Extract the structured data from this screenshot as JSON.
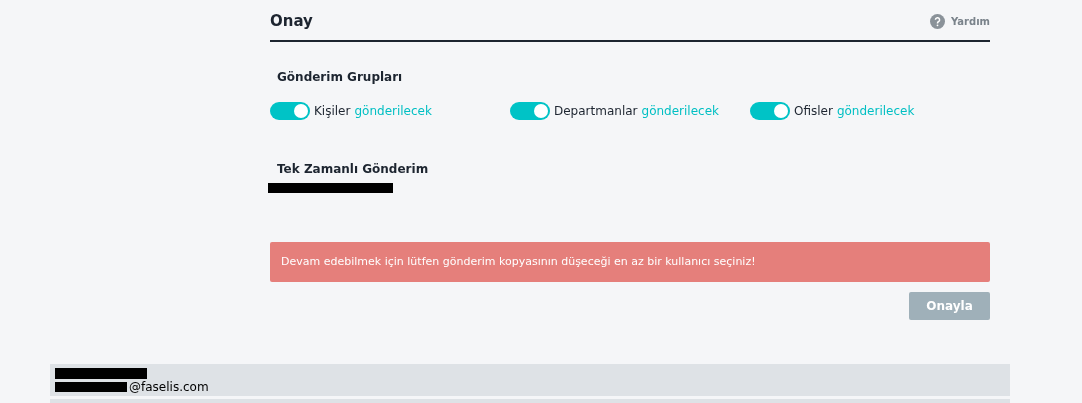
{
  "header": {
    "title": "Onay",
    "help_label": "Yardım"
  },
  "groups": {
    "heading": "Gönderim Grupları",
    "items": [
      {
        "label": "Kişiler",
        "status": "gönderilecek",
        "on": true
      },
      {
        "label": "Departmanlar",
        "status": "gönderilecek",
        "on": true
      },
      {
        "label": "Ofisler",
        "status": "gönderilecek",
        "on": true
      }
    ]
  },
  "schedule": {
    "heading": "Tek Zamanlı Gönderim",
    "value_redacted": true
  },
  "alert": {
    "message": "Devam edebilmek için lütfen gönderim kopyasının düşeceği en az bir kullanıcı seçiniz!"
  },
  "confirm_button": {
    "label": "Onayla",
    "disabled": true
  },
  "users": [
    {
      "kind": "redacted",
      "email": "@faselis.com"
    },
    {
      "kind": "cut_off"
    }
  ]
}
